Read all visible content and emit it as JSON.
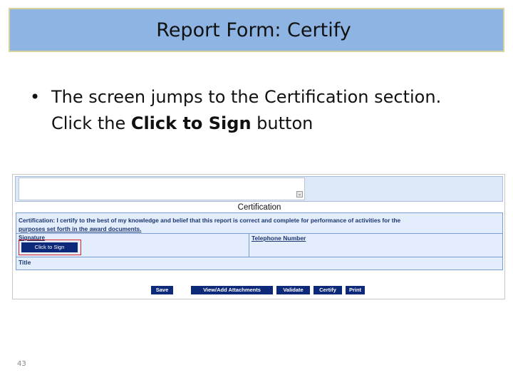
{
  "slide": {
    "title": "Report Form: Certify",
    "bullet": {
      "line1": "The screen jumps to the Certification section.",
      "line2_pre": "Click the ",
      "line2_bold": "Click to Sign",
      "line2_post": " button"
    },
    "page_number": "43"
  },
  "form": {
    "section_heading": "Certification",
    "certification_text": "Certification: I certify to the best of my knowledge and belief that this report is correct and complete for performance of activities for the",
    "certification_text_2": "purposes set forth in the award documents.",
    "signature_label": "Signature",
    "sign_button": "Click to Sign",
    "telephone_label": "Telephone Number",
    "title_label": "Title",
    "buttons": {
      "save": "Save",
      "attachments": "View/Add Attachments",
      "validate": "Validate",
      "certify": "Certify",
      "print": "Print"
    }
  },
  "colors": {
    "title_bar": "#8eb4e3",
    "button_navy": "#0d2a7a",
    "highlight_red": "#d9232e",
    "form_bg": "#e3edfb"
  }
}
